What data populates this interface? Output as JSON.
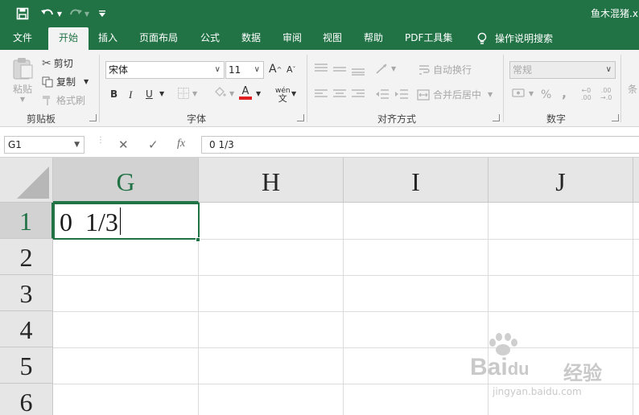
{
  "title_bar": {
    "title": "鱼木混猪.x"
  },
  "tabs": [
    {
      "label": "文件"
    },
    {
      "label": "开始"
    },
    {
      "label": "插入"
    },
    {
      "label": "页面布局"
    },
    {
      "label": "公式"
    },
    {
      "label": "数据"
    },
    {
      "label": "审阅"
    },
    {
      "label": "视图"
    },
    {
      "label": "帮助"
    },
    {
      "label": "PDF工具集"
    },
    {
      "label": "操作说明搜索"
    }
  ],
  "ribbon": {
    "clipboard": {
      "paste": "粘贴",
      "cut": "剪切",
      "copy": "复制",
      "format_painter": "格式刷",
      "group_label": "剪贴板"
    },
    "font": {
      "font_name": "宋体",
      "font_size": "11",
      "grow": "A",
      "shrink": "A",
      "bold": "B",
      "italic": "I",
      "underline": "U",
      "font_color_glyph": "A",
      "phonetic": "wén",
      "group_label": "字体"
    },
    "alignment": {
      "wrap_text": "自动换行",
      "merge_center": "合并后居中",
      "group_label": "对齐方式"
    },
    "number": {
      "format": "常规",
      "percent": "%",
      "comma": ",",
      "inc_decimal_top": "←0",
      "inc_decimal_bottom": ".00",
      "dec_decimal_top": ".00",
      "dec_decimal_bottom": "→.0",
      "group_label": "数字"
    },
    "styles": {
      "conditional_partial": "条"
    }
  },
  "formula_bar": {
    "name_box": "G1",
    "cancel": "✕",
    "enter": "✓",
    "fx": "fx",
    "content": "0 1/3"
  },
  "grid": {
    "columns": [
      "G",
      "H",
      "I",
      "J"
    ],
    "rows": [
      "1",
      "2",
      "3",
      "4",
      "5",
      "6"
    ],
    "active_cell_value": "0  1/3"
  },
  "watermark": {
    "brand": "Bai",
    "brand_du": "du",
    "jingyan": "经验",
    "url": "jingyan.baidu.com"
  },
  "colors": {
    "excel_green": "#217346",
    "ribbon_bg": "#f3f3f3",
    "header_bg": "#e6e6e6",
    "header_selected_bg": "#d2d2d2"
  }
}
